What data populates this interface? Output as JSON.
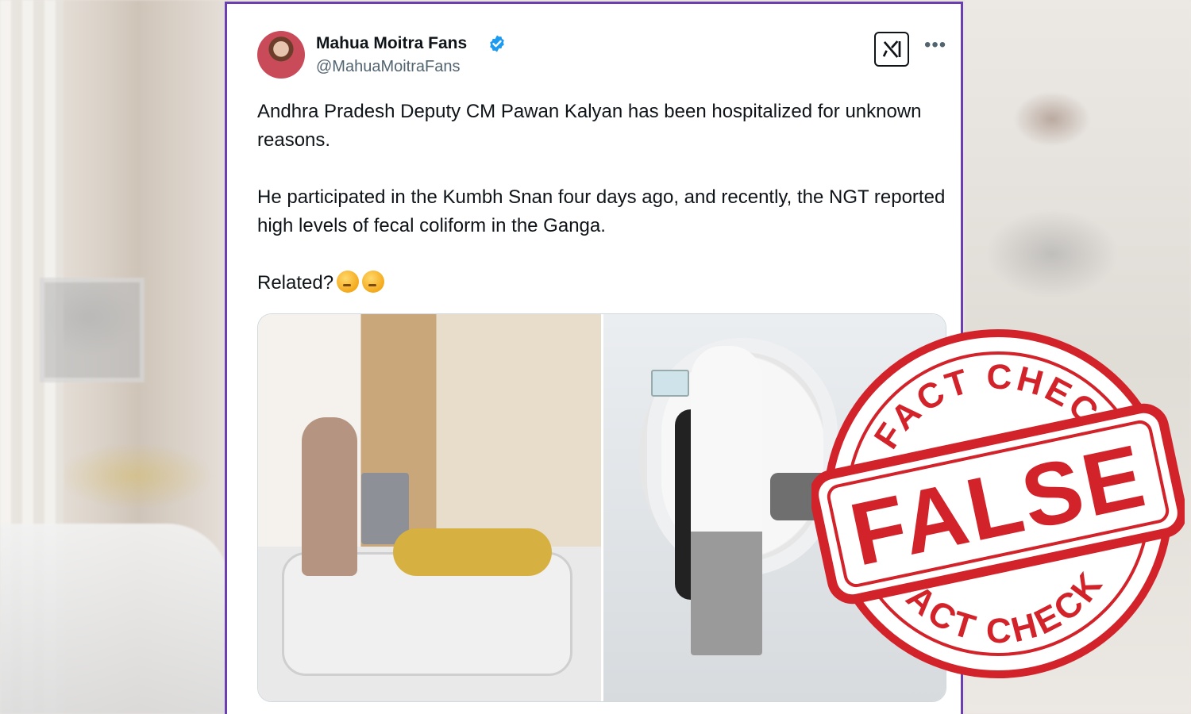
{
  "tweet": {
    "author_name": "Mahua Moitra Fans",
    "author_handle": "@MahuaMoitraFans",
    "verified": true,
    "paragraph_1": "Andhra Pradesh Deputy CM Pawan Kalyan has been hospitalized for unknown reasons.",
    "paragraph_2": "He participated in the Kumbh Snan four days ago, and recently, the NGT reported high levels of fecal coliform in the Ganga.",
    "paragraph_3": "Related?",
    "emojis": [
      "thinking-face-emoji",
      "thinking-face-emoji"
    ]
  },
  "stamp": {
    "top_text": "FACT CHECK",
    "center_text": "FALSE",
    "bottom_text": "FACT CHECK",
    "color": "#d3232a"
  },
  "colors": {
    "card_border": "#6c3fb0",
    "verified_badge": "#1d9bf0"
  }
}
